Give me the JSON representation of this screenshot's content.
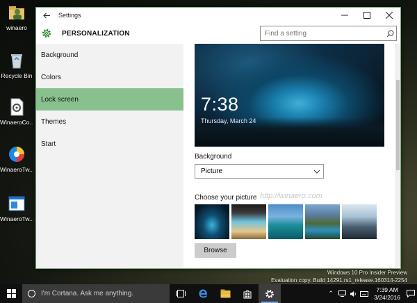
{
  "desktop": {
    "icons": [
      {
        "label": "winaero",
        "icon": "user-folder-icon"
      },
      {
        "label": "Recycle Bin",
        "icon": "recycle-bin-icon"
      },
      {
        "label": "WinaeroCo...",
        "icon": "document-icon"
      },
      {
        "label": "WinaeroTw...",
        "icon": "app-icon"
      },
      {
        "label": "WinaeroTw...",
        "icon": "app-window-icon"
      }
    ]
  },
  "window": {
    "title": "Settings",
    "heading": "PERSONALIZATION",
    "search_placeholder": "Find a setting",
    "nav": [
      {
        "label": "Background",
        "active": false
      },
      {
        "label": "Colors",
        "active": false
      },
      {
        "label": "Lock screen",
        "active": true
      },
      {
        "label": "Themes",
        "active": false
      },
      {
        "label": "Start",
        "active": false
      }
    ],
    "preview": {
      "time": "7:38",
      "date": "Thursday, March 24"
    },
    "background_label": "Background",
    "background_value": "Picture",
    "choose_label": "Choose your picture",
    "watermark": "http://winaero.com",
    "browse_label": "Browse",
    "accent_color": "#88c08e"
  },
  "os_watermark": {
    "line1": "Windows 10 Pro Insider Preview",
    "line2": "Evaluation copy. Build 14291.rs1_release.160314-2254"
  },
  "taskbar": {
    "search_placeholder": "I'm Cortana. Ask me anything.",
    "apps": [
      "task-view-icon",
      "edge-icon",
      "file-explorer-icon",
      "store-icon",
      "settings-icon"
    ],
    "time": "7:39 AM",
    "date": "3/24/2016"
  }
}
